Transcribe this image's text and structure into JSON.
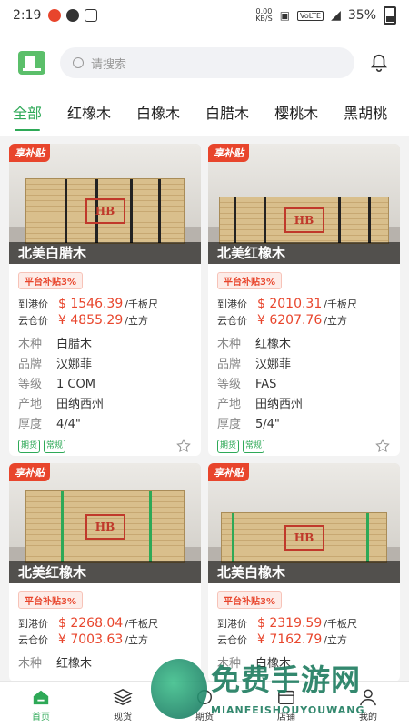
{
  "status_bar": {
    "time": "2:19",
    "net_speed": "0.00",
    "net_unit": "KB/S",
    "network": "VoLTE",
    "battery": "35%"
  },
  "header": {
    "search_placeholder": "请搜索"
  },
  "tabs": [
    "全部",
    "红橡木",
    "白橡木",
    "白腊木",
    "樱桃木",
    "黑胡桃"
  ],
  "products": [
    {
      "badge": "享补贴",
      "title": "北美白腊木",
      "subsidy": "平台补贴3%",
      "port_label": "到港价",
      "port_price": "$ 1546.39",
      "port_unit": "/千板尺",
      "cloud_label": "云仓价",
      "cloud_price": "¥ 4855.29",
      "cloud_unit": "/立方",
      "attrs": [
        {
          "k": "木种",
          "v": "白腊木"
        },
        {
          "k": "品牌",
          "v": "汉娜菲"
        },
        {
          "k": "等级",
          "v": "1 COM"
        },
        {
          "k": "产地",
          "v": "田纳西州"
        },
        {
          "k": "厚度",
          "v": "4/4\""
        }
      ],
      "tags": [
        "期货",
        "常规"
      ],
      "logo_text": "HB"
    },
    {
      "badge": "享补贴",
      "title": "北美红橡木",
      "subsidy": "平台补贴3%",
      "port_label": "到港价",
      "port_price": "$ 2010.31",
      "port_unit": "/千板尺",
      "cloud_label": "云仓价",
      "cloud_price": "¥ 6207.76",
      "cloud_unit": "/立方",
      "attrs": [
        {
          "k": "木种",
          "v": "红橡木"
        },
        {
          "k": "品牌",
          "v": "汉娜菲"
        },
        {
          "k": "等级",
          "v": "FAS"
        },
        {
          "k": "产地",
          "v": "田纳西州"
        },
        {
          "k": "厚度",
          "v": "5/4\""
        }
      ],
      "tags": [
        "期货",
        "常规"
      ],
      "logo_text": "HB"
    },
    {
      "badge": "享补贴",
      "title": "北美红橡木",
      "subsidy": "平台补贴3%",
      "port_label": "到港价",
      "port_price": "$ 2268.04",
      "port_unit": "/千板尺",
      "cloud_label": "云仓价",
      "cloud_price": "¥ 7003.63",
      "cloud_unit": "/立方",
      "attrs": [
        {
          "k": "木种",
          "v": "红橡木"
        }
      ],
      "tags": [],
      "logo_text": "HB"
    },
    {
      "badge": "享补贴",
      "title": "北美白橡木",
      "subsidy": "平台补贴3%",
      "port_label": "到港价",
      "port_price": "$ 2319.59",
      "port_unit": "/千板尺",
      "cloud_label": "云仓价",
      "cloud_price": "¥ 7162.79",
      "cloud_unit": "/立方",
      "attrs": [
        {
          "k": "木种",
          "v": "白橡木"
        }
      ],
      "tags": [],
      "logo_text": "HB"
    }
  ],
  "bottom_nav": [
    "首页",
    "现货",
    "期货",
    "店铺",
    "我的"
  ],
  "watermark": {
    "big": "免费手游网",
    "small": "MIANFEISHOUYOUWANG"
  },
  "colors": {
    "accent": "#2ea957",
    "price": "#e8452c"
  }
}
